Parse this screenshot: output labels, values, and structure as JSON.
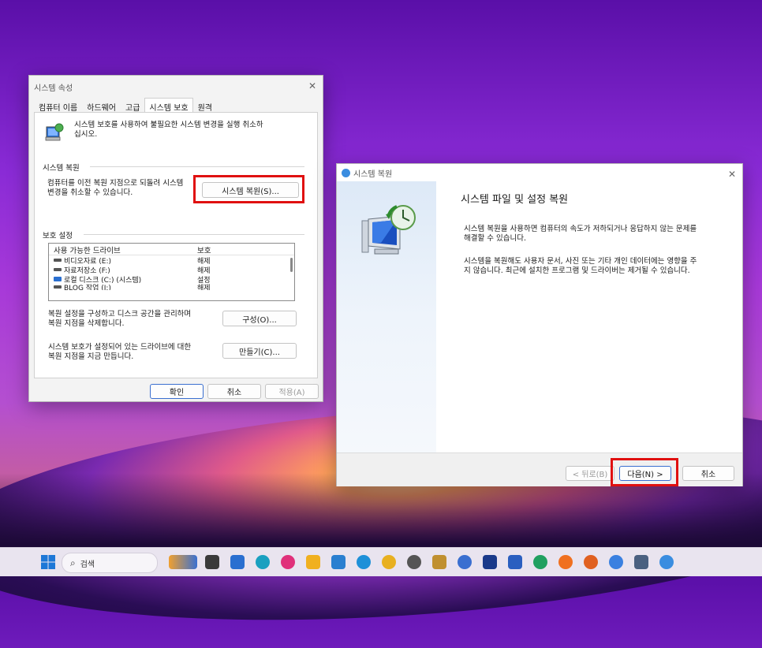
{
  "sysprop": {
    "title": "시스템 속성",
    "tabs": [
      "컴퓨터 이름",
      "하드웨어",
      "고급",
      "시스템 보호",
      "원격"
    ],
    "active_tab": "시스템 보호",
    "intro_line1": "시스템 보호를 사용하여 불필요한 시스템 변경을 실행 취소하",
    "intro_line2": "십시오.",
    "restore_section": "시스템 복원",
    "restore_desc1": "컴퓨터를 이전 복원 지점으로 되돌려 시스템",
    "restore_desc2": "변경을 취소할 수 있습니다.",
    "restore_button": "시스템 복원(S)...",
    "protect_section": "보호 설정",
    "drive_head_name": "사용 가능한 드라이브",
    "drive_head_state": "보호",
    "drives": [
      {
        "name": "비디오자료 (E:)",
        "state": "해제"
      },
      {
        "name": "자료저장소 (F:)",
        "state": "해제"
      },
      {
        "name": "로컬 디스크 (C:) (시스템)",
        "state": "설정"
      },
      {
        "name": "BLOG 작업 (I:)",
        "state": "해제"
      }
    ],
    "config_desc1": "복원 설정을 구성하고 디스크 공간을 관리하며",
    "config_desc2": "복원 지점을 삭제합니다.",
    "config_button": "구성(O)...",
    "create_desc1": "시스템 보호가 설정되어 있는 드라이브에 대한",
    "create_desc2": "복원 지점을 지금 만듭니다.",
    "create_button": "만들기(C)...",
    "ok": "확인",
    "cancel": "취소",
    "apply": "적용(A)"
  },
  "wizard": {
    "title": "시스템 복원",
    "heading": "시스템 파일 및 설정 복원",
    "para1_line1": "시스템 복원을 사용하면 컴퓨터의 속도가 저하되거나 응답하지 않는 문제를",
    "para1_line2": "해결할 수 있습니다.",
    "para2_line1": "시스템을 복원해도 사용자 문서, 사진 또는 기타 개인 데이터에는 영향을 주",
    "para2_line2": "지 않습니다. 최근에 설치한 프로그램 및 드라이버는 제거될 수 있습니다.",
    "back": "< 뒤로(B)",
    "next": "다음(N) >",
    "cancel": "취소"
  },
  "taskbar": {
    "search": "검색"
  }
}
